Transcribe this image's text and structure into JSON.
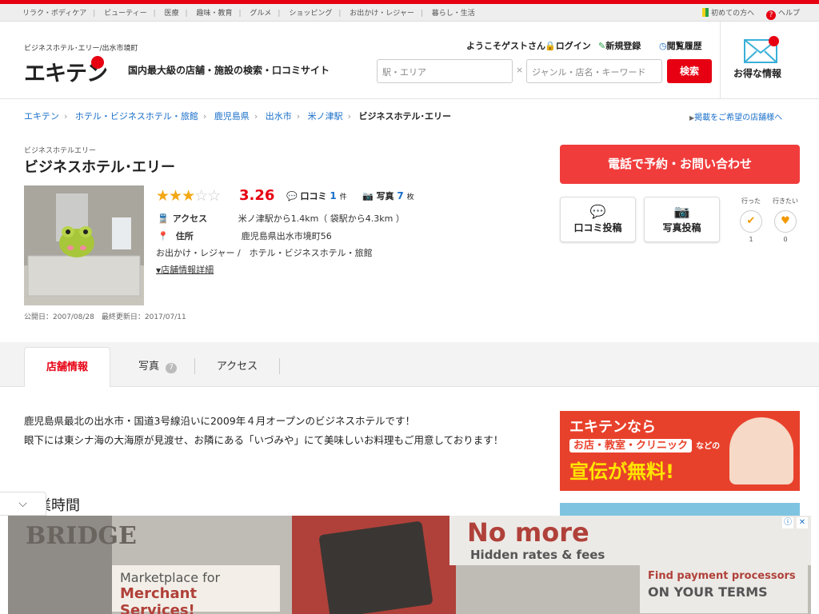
{
  "top_nav": {
    "categories": [
      "リラク・ボディケア",
      "ビューティー",
      "医療",
      "趣味・教育",
      "グルメ",
      "ショッピング",
      "お出かけ・レジャー",
      "暮らし・生活"
    ],
    "beginner": "初めての方へ",
    "help": "ヘルプ"
  },
  "header": {
    "logo_sub": "ビジネスホテル･エリー/出水市境町",
    "logo": "エキテン",
    "tagline": "国内最大級の店舗・施設の検索・口コミサイト",
    "welcome": "ようこそゲストさん",
    "login": "ログイン",
    "register": "新規登録",
    "history": "閲覧履歴",
    "search_station_placeholder": "駅・エリア",
    "search_clear": "×",
    "search_keyword_placeholder": "ジャンル・店名・キーワード",
    "search_button": "検索",
    "deals": "お得な情報"
  },
  "breadcrumb": [
    "エキテン",
    "ホテル・ビジネスホテル・旅館",
    "鹿児島県",
    "出水市",
    "米ノ津駅"
  ],
  "breadcrumb_current": "ビジネスホテル･エリー",
  "ad_link": "掲載をご希望の店舗様へ",
  "shop": {
    "subname": "ビジネスホテルエリー",
    "name": "ビジネスホテル･エリー",
    "rating": 3.26,
    "rating_text": "3.26",
    "reviews_label": "口コミ",
    "reviews_count": "1",
    "reviews_unit": "件",
    "photos_label": "写真",
    "photos_count": "7",
    "photos_unit": "枚",
    "access_label": "アクセス",
    "access_value": "米ノ津駅から1.4km（ 袋駅から4.3km ）",
    "address_label": "住所",
    "address_value": "鹿児島県出水市境町56",
    "categories": "お出かけ・レジャー /　ホテル・ビジネスホテル・旅館",
    "details_link": "店舗情報詳細",
    "published": "公開日：2007/08/28　最終更新日：2017/07/11"
  },
  "actions": {
    "call": "電話で予約・お問い合わせ",
    "post_review": "口コミ投稿",
    "post_photo": "写真投稿",
    "went_label": "行った",
    "went_count": "1",
    "want_label": "行きたい",
    "want_count": "0"
  },
  "tabs": {
    "info": "店舗情報",
    "photos": "写真",
    "photos_badge": "7",
    "access": "アクセス"
  },
  "description": [
    "鹿児島県最北の出水市・国道3号線沿いに2009年４月オープンのビジネスホテルです！",
    "眼下には東シナ海の大海原が見渡せ、お隣にある「いづみや」にて美味しいお料理もご用意しております！"
  ],
  "hours_heading": "業時間",
  "promo": {
    "line1": "エキテンなら",
    "line2": "お店・教室・クリニック",
    "line3": "などの",
    "line4": "宣伝が無料!"
  },
  "bottom_ad": {
    "brand": "BRIDGE",
    "headline": "No more",
    "sub": "Hidden rates & fees",
    "market1": "Marketplace for",
    "market2": "Merchant Services!",
    "find1": "Find payment processors",
    "find2": "ON YOUR TERMS"
  },
  "colors": {
    "brand": "#e60012",
    "link": "#1a6fc9",
    "star": "#f3a712"
  }
}
